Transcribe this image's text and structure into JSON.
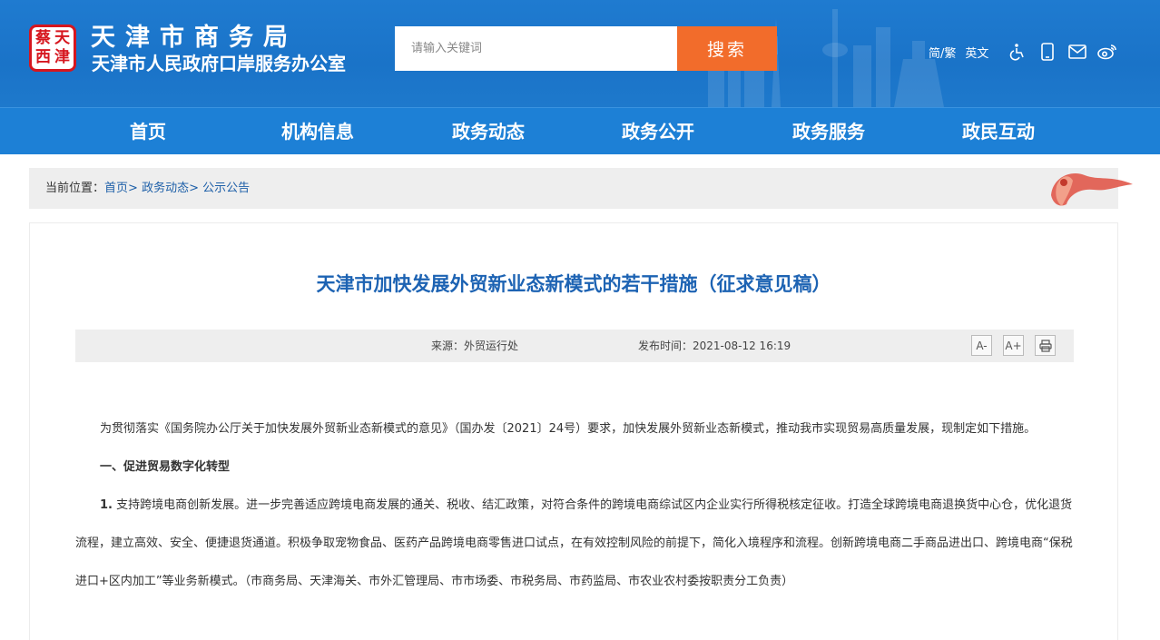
{
  "header": {
    "logo_chars": [
      "津",
      "天",
      "蔡",
      "西"
    ],
    "title": "天津市商务局",
    "subtitle": "天津市人民政府口岸服务办公室",
    "search_placeholder": "请输入关键词",
    "search_button": "搜索",
    "tools": {
      "simplified_traditional": "简/繁",
      "english": "英文",
      "icons": [
        "accessibility-icon",
        "mobile-icon",
        "mail-icon",
        "weibo-icon"
      ]
    }
  },
  "nav": {
    "items": [
      "首页",
      "机构信息",
      "政务动态",
      "政务公开",
      "政务服务",
      "政民互动"
    ]
  },
  "breadcrumb": {
    "label": "当前位置：",
    "items": [
      "首页>",
      "政务动态>",
      "公示公告"
    ]
  },
  "article": {
    "title": "天津市加快发展外贸新业态新模式的若干措施（征求意见稿）",
    "source": "来源：外贸运行处",
    "publish_time": "发布时间：2021-08-12 16:19",
    "font_smaller": "A-",
    "font_larger": "A+",
    "print": "print-icon",
    "paragraph1": "为贯彻落实《国务院办公厅关于加快发展外贸新业态新模式的意见》（国办发〔2021〕24号）要求，加快发展外贸新业态新模式，推动我市实现贸易高质量发展，现制定如下措施。",
    "section1_heading": "一、促进贸易数字化转型",
    "item1_number": "1.",
    "item1_text": " 支持跨境电商创新发展。进一步完善适应跨境电商发展的通关、税收、结汇政策，对符合条件的跨境电商综试区内企业实行所得税核定征收。打造全球跨境电商退换货中心仓，优化退货流程，建立高效、安全、便捷退货通道。积极争取宠物食品、医药产品跨境电商零售进口试点，在有效控制风险的前提下，简化入境程序和流程。创新跨境电商二手商品进出口、跨境电商“保税进口+区内加工”等业务新模式。（市商务局、天津海关、市外汇管理局、市市场委、市税务局、市药监局、市农业农村委按职责分工负责）"
  },
  "colors": {
    "header_blue": "#1a73c8",
    "nav_blue": "#1d80d6",
    "search_orange": "#f26c2b",
    "title_blue": "#1d63b3",
    "logo_red": "#d6161e"
  }
}
